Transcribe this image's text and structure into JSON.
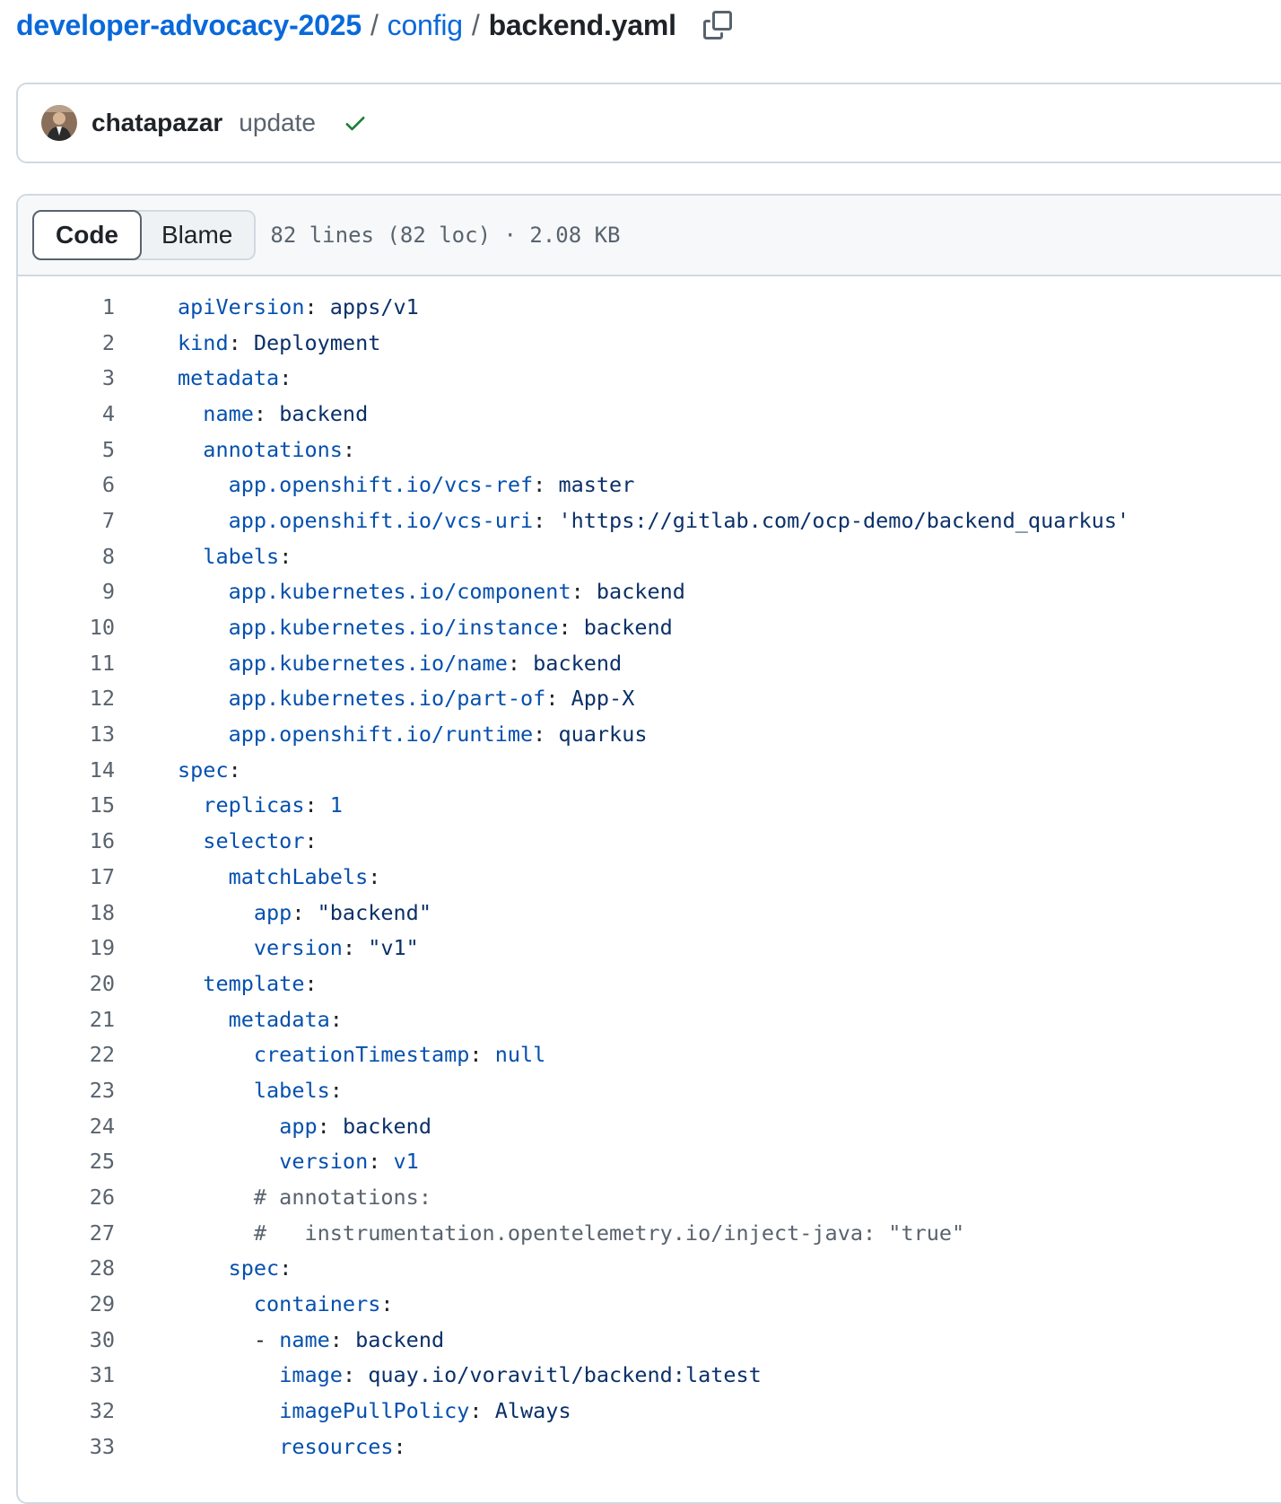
{
  "breadcrumb": {
    "repo": "developer-advocacy-2025",
    "folder": "config",
    "file": "backend.yaml",
    "separator": "/"
  },
  "commit": {
    "author": "chatapazar",
    "message": "update",
    "status": "success",
    "status_color": "#1a7f37"
  },
  "file_header": {
    "tabs": [
      {
        "label": "Code",
        "active": true
      },
      {
        "label": "Blame",
        "active": false
      }
    ],
    "meta": "82 lines (82 loc) · 2.08 KB"
  },
  "code_lines": [
    {
      "n": "1",
      "indent": "",
      "key": "apiVersion",
      "sep": ": ",
      "val": "apps/v1"
    },
    {
      "n": "2",
      "indent": "",
      "key": "kind",
      "sep": ": ",
      "val": "Deployment"
    },
    {
      "n": "3",
      "indent": "",
      "key": "metadata",
      "sep": ":",
      "val": ""
    },
    {
      "n": "4",
      "indent": "  ",
      "key": "name",
      "sep": ": ",
      "val": "backend"
    },
    {
      "n": "5",
      "indent": "  ",
      "key": "annotations",
      "sep": ":",
      "val": ""
    },
    {
      "n": "6",
      "indent": "    ",
      "key": "app.openshift.io/vcs-ref",
      "sep": ": ",
      "val": "master"
    },
    {
      "n": "7",
      "indent": "    ",
      "key": "app.openshift.io/vcs-uri",
      "sep": ": ",
      "val": "'https://gitlab.com/ocp-demo/backend_quarkus'"
    },
    {
      "n": "8",
      "indent": "  ",
      "key": "labels",
      "sep": ":",
      "val": ""
    },
    {
      "n": "9",
      "indent": "    ",
      "key": "app.kubernetes.io/component",
      "sep": ": ",
      "val": "backend"
    },
    {
      "n": "10",
      "indent": "    ",
      "key": "app.kubernetes.io/instance",
      "sep": ": ",
      "val": "backend"
    },
    {
      "n": "11",
      "indent": "    ",
      "key": "app.kubernetes.io/name",
      "sep": ": ",
      "val": "backend"
    },
    {
      "n": "12",
      "indent": "    ",
      "key": "app.kubernetes.io/part-of",
      "sep": ": ",
      "val": "App-X"
    },
    {
      "n": "13",
      "indent": "    ",
      "key": "app.openshift.io/runtime",
      "sep": ": ",
      "val": "quarkus"
    },
    {
      "n": "14",
      "indent": "",
      "key": "spec",
      "sep": ":",
      "val": ""
    },
    {
      "n": "15",
      "indent": "  ",
      "key": "replicas",
      "sep": ": ",
      "val": "1",
      "valkey": true
    },
    {
      "n": "16",
      "indent": "  ",
      "key": "selector",
      "sep": ":",
      "val": ""
    },
    {
      "n": "17",
      "indent": "    ",
      "key": "matchLabels",
      "sep": ":",
      "val": ""
    },
    {
      "n": "18",
      "indent": "      ",
      "key": "app",
      "sep": ": ",
      "val": "\"backend\""
    },
    {
      "n": "19",
      "indent": "      ",
      "key": "version",
      "sep": ": ",
      "val": "\"v1\""
    },
    {
      "n": "20",
      "indent": "  ",
      "key": "template",
      "sep": ":",
      "val": ""
    },
    {
      "n": "21",
      "indent": "    ",
      "key": "metadata",
      "sep": ":",
      "val": ""
    },
    {
      "n": "22",
      "indent": "      ",
      "key": "creationTimestamp",
      "sep": ": ",
      "val": "null",
      "valkey": true
    },
    {
      "n": "23",
      "indent": "      ",
      "key": "labels",
      "sep": ":",
      "val": ""
    },
    {
      "n": "24",
      "indent": "        ",
      "key": "app",
      "sep": ": ",
      "val": "backend"
    },
    {
      "n": "25",
      "indent": "        ",
      "key": "version",
      "sep": ": ",
      "val": "v1",
      "valkey": true
    },
    {
      "n": "26",
      "indent": "      ",
      "comment": "# annotations:"
    },
    {
      "n": "27",
      "indent": "      ",
      "comment": "#   instrumentation.opentelemetry.io/inject-java: \"true\""
    },
    {
      "n": "28",
      "indent": "    ",
      "key": "spec",
      "sep": ":",
      "val": ""
    },
    {
      "n": "29",
      "indent": "      ",
      "key": "containers",
      "sep": ":",
      "val": ""
    },
    {
      "n": "30",
      "indent": "      ",
      "dash": "- ",
      "key": "name",
      "sep": ": ",
      "val": "backend"
    },
    {
      "n": "31",
      "indent": "        ",
      "key": "image",
      "sep": ": ",
      "val": "quay.io/voravitl/backend:latest"
    },
    {
      "n": "32",
      "indent": "        ",
      "key": "imagePullPolicy",
      "sep": ": ",
      "val": "Always"
    },
    {
      "n": "33",
      "indent": "        ",
      "key": "resources",
      "sep": ":",
      "val": ""
    }
  ]
}
